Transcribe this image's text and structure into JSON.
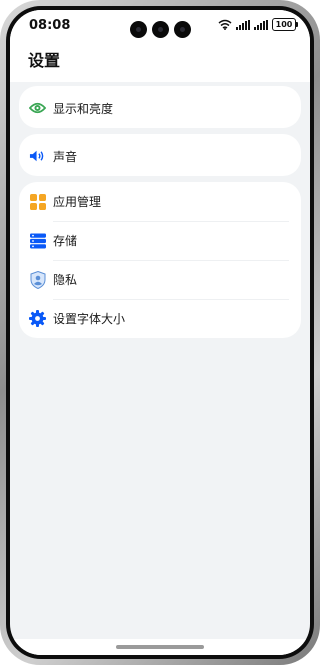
{
  "status": {
    "time": "08:08",
    "battery": "100"
  },
  "page": {
    "title": "设置"
  },
  "groups": [
    {
      "items": [
        {
          "label": "显示和亮度",
          "icon": "eye-icon"
        }
      ]
    },
    {
      "items": [
        {
          "label": "声音",
          "icon": "speaker-icon"
        }
      ]
    },
    {
      "items": [
        {
          "label": "应用管理",
          "icon": "apps-grid-icon"
        },
        {
          "label": "存储",
          "icon": "storage-icon"
        },
        {
          "label": "隐私",
          "icon": "privacy-shield-icon"
        },
        {
          "label": "设置字体大小",
          "icon": "gear-icon"
        }
      ]
    }
  ],
  "colors": {
    "background": "#f1f3f5",
    "card": "#ffffff",
    "accent_blue": "#0a59f7",
    "eye_green": "#3aa654",
    "apps_orange": "#f5a623"
  }
}
